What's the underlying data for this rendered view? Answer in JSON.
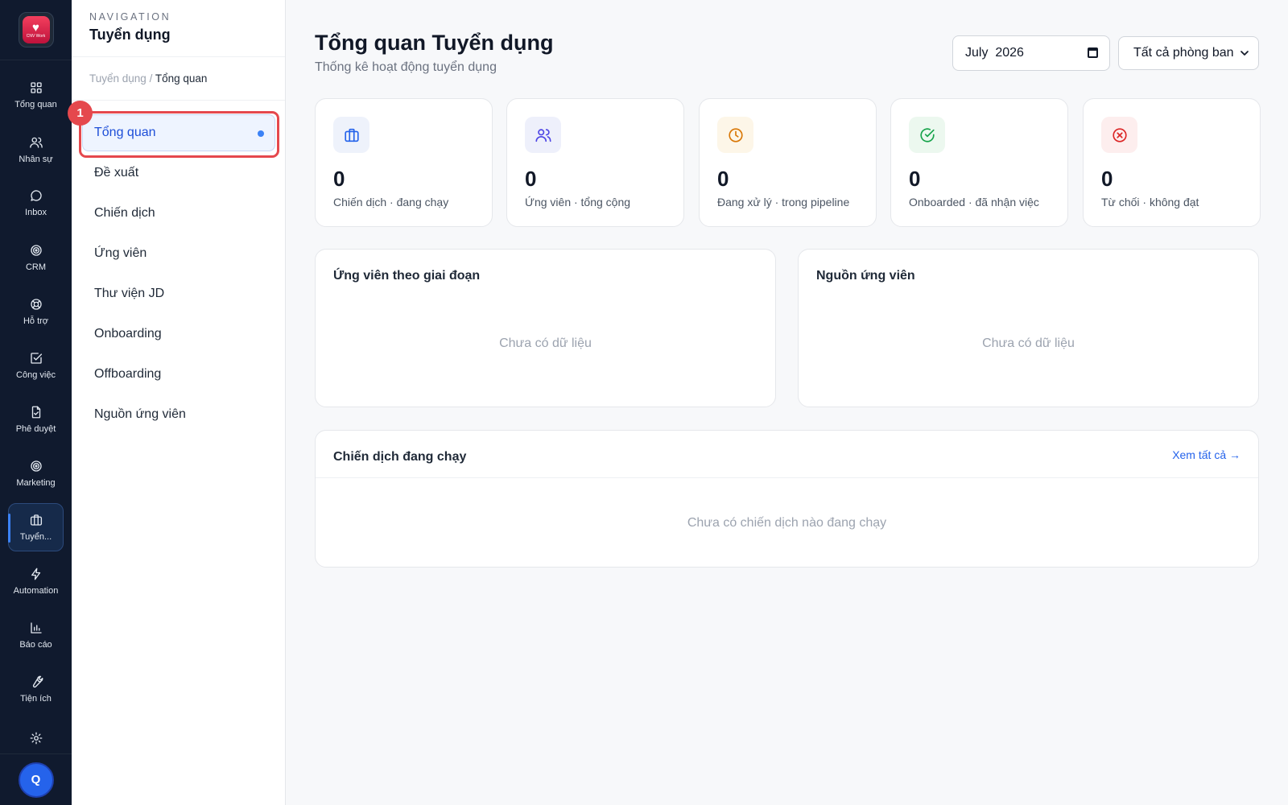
{
  "app": {
    "logo_text": "CNV Work",
    "avatar_initial": "Q"
  },
  "rail": {
    "items": [
      {
        "label": "Tổng quan",
        "icon": "grid-icon"
      },
      {
        "label": "Nhân sự",
        "icon": "users-icon"
      },
      {
        "label": "Inbox",
        "icon": "chat-icon"
      },
      {
        "label": "CRM",
        "icon": "target-icon"
      },
      {
        "label": "Hỗ trợ",
        "icon": "lifebuoy-icon"
      },
      {
        "label": "Công việc",
        "icon": "check-square-icon"
      },
      {
        "label": "Phê duyệt",
        "icon": "file-check-icon"
      },
      {
        "label": "Marketing",
        "icon": "target-icon"
      },
      {
        "label": "Tuyển...",
        "icon": "briefcase-icon",
        "active": true
      },
      {
        "label": "Automation",
        "icon": "bolt-icon"
      },
      {
        "label": "Báo cáo",
        "icon": "bar-chart-icon"
      },
      {
        "label": "Tiện ích",
        "icon": "wrench-icon"
      }
    ]
  },
  "subnav": {
    "eyebrow": "NAVIGATION",
    "title": "Tuyển dụng",
    "breadcrumb": {
      "parent": "Tuyển dụng",
      "separator": "/",
      "current": "Tổng quan"
    },
    "items": [
      {
        "label": "Tổng quan",
        "active": true
      },
      {
        "label": "Đề xuất"
      },
      {
        "label": "Chiến dịch"
      },
      {
        "label": "Ứng viên"
      },
      {
        "label": "Thư viện JD"
      },
      {
        "label": "Onboarding"
      },
      {
        "label": "Offboarding"
      },
      {
        "label": "Nguồn ứng viên"
      }
    ],
    "annotation_number": "1"
  },
  "header": {
    "title": "Tổng quan Tuyển dụng",
    "subtitle": "Thống kê hoạt động tuyển dụng",
    "month_value": "July  2026",
    "department_value": "Tất cả phòng ban"
  },
  "stats": [
    {
      "value": "0",
      "label": "Chiến dịch · đang chạy",
      "icon": "briefcase-icon",
      "color": "#2563eb",
      "bg": "#eef2fb"
    },
    {
      "value": "0",
      "label": "Ứng viên · tổng cộng",
      "icon": "users-icon",
      "color": "#4f46e5",
      "bg": "#eef0fb"
    },
    {
      "value": "0",
      "label": "Đang xử lý · trong pipeline",
      "icon": "clock-icon",
      "color": "#d97706",
      "bg": "#fdf6e8"
    },
    {
      "value": "0",
      "label": "Onboarded · đã nhận việc",
      "icon": "check-circle-icon",
      "color": "#16a34a",
      "bg": "#ecf8ef"
    },
    {
      "value": "0",
      "label": "Từ chối · không đạt",
      "icon": "x-circle-icon",
      "color": "#dc2626",
      "bg": "#fdeeee"
    }
  ],
  "panels": {
    "stage": {
      "title": "Ứng viên theo giai đoạn",
      "empty": "Chưa có dữ liệu"
    },
    "source": {
      "title": "Nguồn ứng viên",
      "empty": "Chưa có dữ liệu"
    },
    "campaigns": {
      "title": "Chiến dịch đang chạy",
      "view_all": "Xem tất cả →",
      "empty": "Chưa có chiến dịch nào đang chạy"
    }
  }
}
